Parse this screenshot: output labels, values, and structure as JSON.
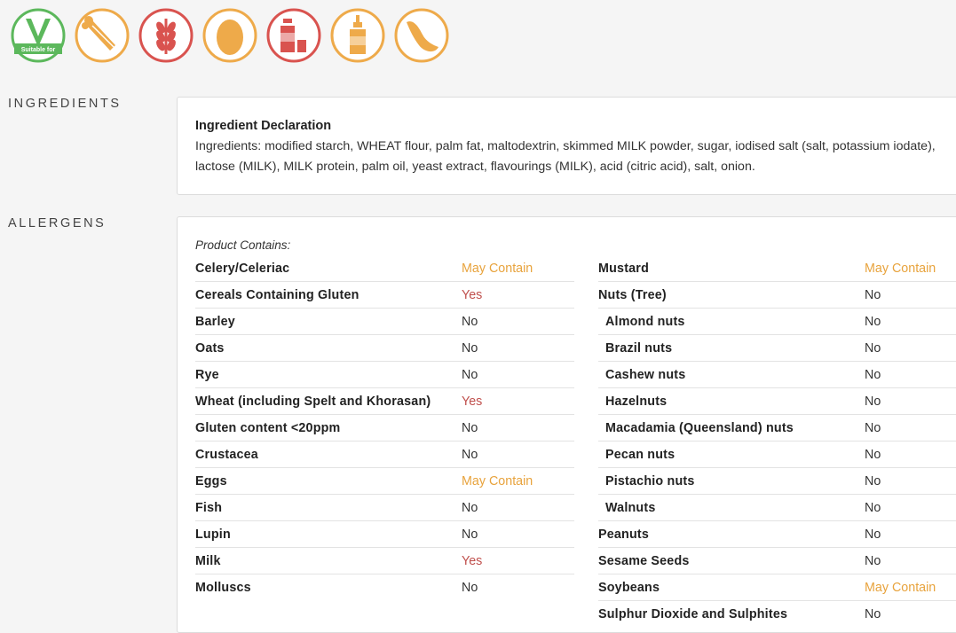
{
  "badges": [
    {
      "name": "suitable-for-vegetarians-icon",
      "color": "#5cb85c",
      "label": "Suitable for"
    },
    {
      "name": "celery-icon",
      "color": "#eeaa4a"
    },
    {
      "name": "wheat-icon",
      "color": "#d9534f"
    },
    {
      "name": "egg-icon",
      "color": "#eeaa4a"
    },
    {
      "name": "milk-icon",
      "color": "#d9534f"
    },
    {
      "name": "mustard-icon",
      "color": "#eeaa4a"
    },
    {
      "name": "soybean-icon",
      "color": "#eeaa4a"
    }
  ],
  "ingredients": {
    "label": "INGREDIENTS",
    "title": "Ingredient Declaration",
    "text": "Ingredients: modified starch, WHEAT flour, palm fat, maltodextrin, skimmed MILK powder, sugar, iodised salt (salt, potassium iodate), lactose (MILK), MILK protein, palm oil, yeast extract, flavourings (MILK), acid (citric acid), salt, onion."
  },
  "allergens": {
    "label": "ALLERGENS",
    "contains_label": "Product Contains:",
    "left": [
      {
        "name": "Celery/Celeriac",
        "value": "May Contain"
      },
      {
        "name": "Cereals Containing Gluten",
        "value": "Yes"
      },
      {
        "name": "Barley",
        "value": "No"
      },
      {
        "name": "Oats",
        "value": "No"
      },
      {
        "name": "Rye",
        "value": "No"
      },
      {
        "name": "Wheat (including Spelt and Khorasan)",
        "value": "Yes"
      },
      {
        "name": "Gluten content <20ppm",
        "value": "No"
      },
      {
        "name": "Crustacea",
        "value": "No"
      },
      {
        "name": "Eggs",
        "value": "May Contain"
      },
      {
        "name": "Fish",
        "value": "No"
      },
      {
        "name": "Lupin",
        "value": "No"
      },
      {
        "name": "Milk",
        "value": "Yes"
      },
      {
        "name": "Molluscs",
        "value": "No"
      }
    ],
    "right": [
      {
        "name": "Mustard",
        "value": "May Contain"
      },
      {
        "name": "Nuts (Tree)",
        "value": "No"
      },
      {
        "name": "Almond nuts",
        "value": "No",
        "sub": true
      },
      {
        "name": "Brazil nuts",
        "value": "No",
        "sub": true
      },
      {
        "name": "Cashew nuts",
        "value": "No",
        "sub": true
      },
      {
        "name": "Hazelnuts",
        "value": "No",
        "sub": true
      },
      {
        "name": "Macadamia (Queensland) nuts",
        "value": "No",
        "sub": true
      },
      {
        "name": "Pecan nuts",
        "value": "No",
        "sub": true
      },
      {
        "name": "Pistachio nuts",
        "value": "No",
        "sub": true
      },
      {
        "name": "Walnuts",
        "value": "No",
        "sub": true
      },
      {
        "name": "Peanuts",
        "value": "No"
      },
      {
        "name": "Sesame Seeds",
        "value": "No"
      },
      {
        "name": "Soybeans",
        "value": "May Contain"
      },
      {
        "name": "Sulphur Dioxide and Sulphites",
        "value": "No"
      }
    ]
  }
}
